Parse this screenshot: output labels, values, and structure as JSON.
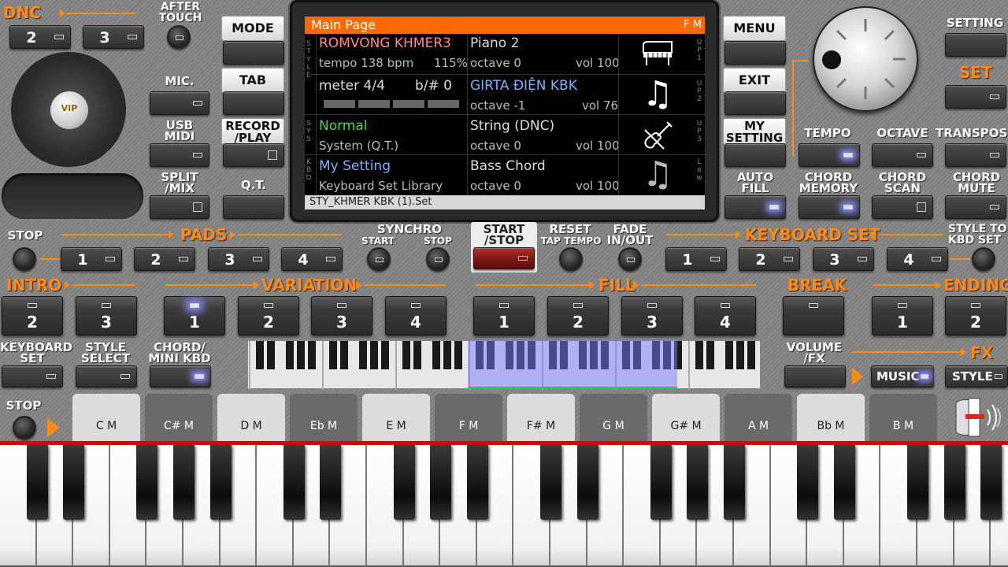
{
  "left": {
    "dnc_label": "DNC",
    "dnc_buttons": [
      "2",
      "3"
    ],
    "after_touch_label": "AFTER\nTOUCH",
    "vip_label": "VIP",
    "mic_label": "MIC.",
    "usb_midi_label": "USB\nMIDI",
    "split_mix_label": "SPLIT\n/MIX"
  },
  "center_left": {
    "mode_label": "MODE",
    "tab_label": "TAB",
    "record_play_label": "RECORD\n/PLAY",
    "qt_label": "Q.T."
  },
  "display": {
    "title": "Main Page",
    "fm": "F M",
    "footer": "STY_KHMER KBK (1).Set",
    "side_labels": [
      "STYLE",
      "SYS",
      "KBD"
    ],
    "right_labels": [
      "UP1",
      "UP2",
      "UP3",
      "Low"
    ],
    "style_name": "ROMVONG KHMER3",
    "tempo": "tempo 138 bpm",
    "tempo_pct": "115%",
    "meter": "meter 4/4",
    "bsharp": "b/#  0",
    "sys_name": "Normal",
    "sys_sub": "System (Q.T.)",
    "kbd_name": "My Setting",
    "kbd_sub": "Keyboard Set Library",
    "voices": [
      {
        "name": "Piano 2",
        "octave": "octave  0",
        "vol": "vol 100",
        "icon": "piano-icon"
      },
      {
        "name": "GIRTA ĐIỆN KBK",
        "octave": "octave -1",
        "vol": "vol 76",
        "icon": "music-note-icon"
      },
      {
        "name": "String (DNC)",
        "octave": "octave  0",
        "vol": "vol 100",
        "icon": "violin-icon"
      },
      {
        "name": "Bass Chord",
        "octave": "octave  0",
        "vol": "vol 100",
        "icon": "music-note-icon"
      }
    ]
  },
  "right": {
    "menu_label": "MENU",
    "exit_label": "EXIT",
    "my_setting_label": "MY\nSETTING",
    "auto_fill_label": "AUTO\nFILL",
    "setting_label": "SETTING",
    "set_label": "SET",
    "tempo_label": "TEMPO",
    "octave_label": "OCTAVE",
    "transpose_label": "TRANSPOS",
    "chord_memory_label": "CHORD\nMEMORY",
    "chord_scan_label": "CHORD\nSCAN",
    "chord_mute_label": "CHORD\nMUTE"
  },
  "row2": {
    "stop_label": "STOP",
    "pads_label": "PADS",
    "pads": [
      "1",
      "2",
      "3",
      "4"
    ],
    "synchro_label": "SYNCHRO",
    "start_label": "START",
    "stop_small_label": "STOP",
    "start_stop_label": "START\n/STOP",
    "reset_label": "RESET",
    "tap_tempo_label": "TAP TEMPO",
    "fade_label": "FADE\nIN/OUT",
    "keyboard_set_label": "KEYBOARD SET",
    "kbd_sets": [
      "1",
      "2",
      "3",
      "4"
    ],
    "style_to_kbd_label": "STYLE TO\nKBD SET"
  },
  "row3": {
    "intro_label": "INTRO",
    "intro": [
      "2",
      "3"
    ],
    "variation_label": "VARIATION",
    "variation": [
      "1",
      "2",
      "3",
      "4"
    ],
    "fill_label": "FILL",
    "fill": [
      "1",
      "2",
      "3",
      "4"
    ],
    "break_label": "BREAK",
    "ending_label": "ENDING",
    "ending": [
      "1",
      "2"
    ]
  },
  "row4": {
    "keyboard_set_label": "KEYBOARD\nSET",
    "style_select_label": "STYLE\nSELECT",
    "chord_mini_label": "CHORD/\nMINI KBD",
    "volume_fx_label": "VOLUME\n/FX",
    "fx_label": "FX",
    "music_label": "MUSIC",
    "style_label": "STYLE"
  },
  "chords": {
    "stop_label": "STOP",
    "items": [
      "C M",
      "C# M",
      "D M",
      "Eb M",
      "E M",
      "F M",
      "F# M",
      "G M",
      "G# M",
      "A M",
      "Bb M",
      "B M"
    ]
  },
  "colors": {
    "accent": "#ff8a1c",
    "led_on": "#8a8aff",
    "display_title_bg": "#ff6a00",
    "style_name": "#ff8a8a",
    "sys_name": "#3fdc5a",
    "kbd_name": "#7fb0ff",
    "start_stop": "#8c1c1c"
  }
}
